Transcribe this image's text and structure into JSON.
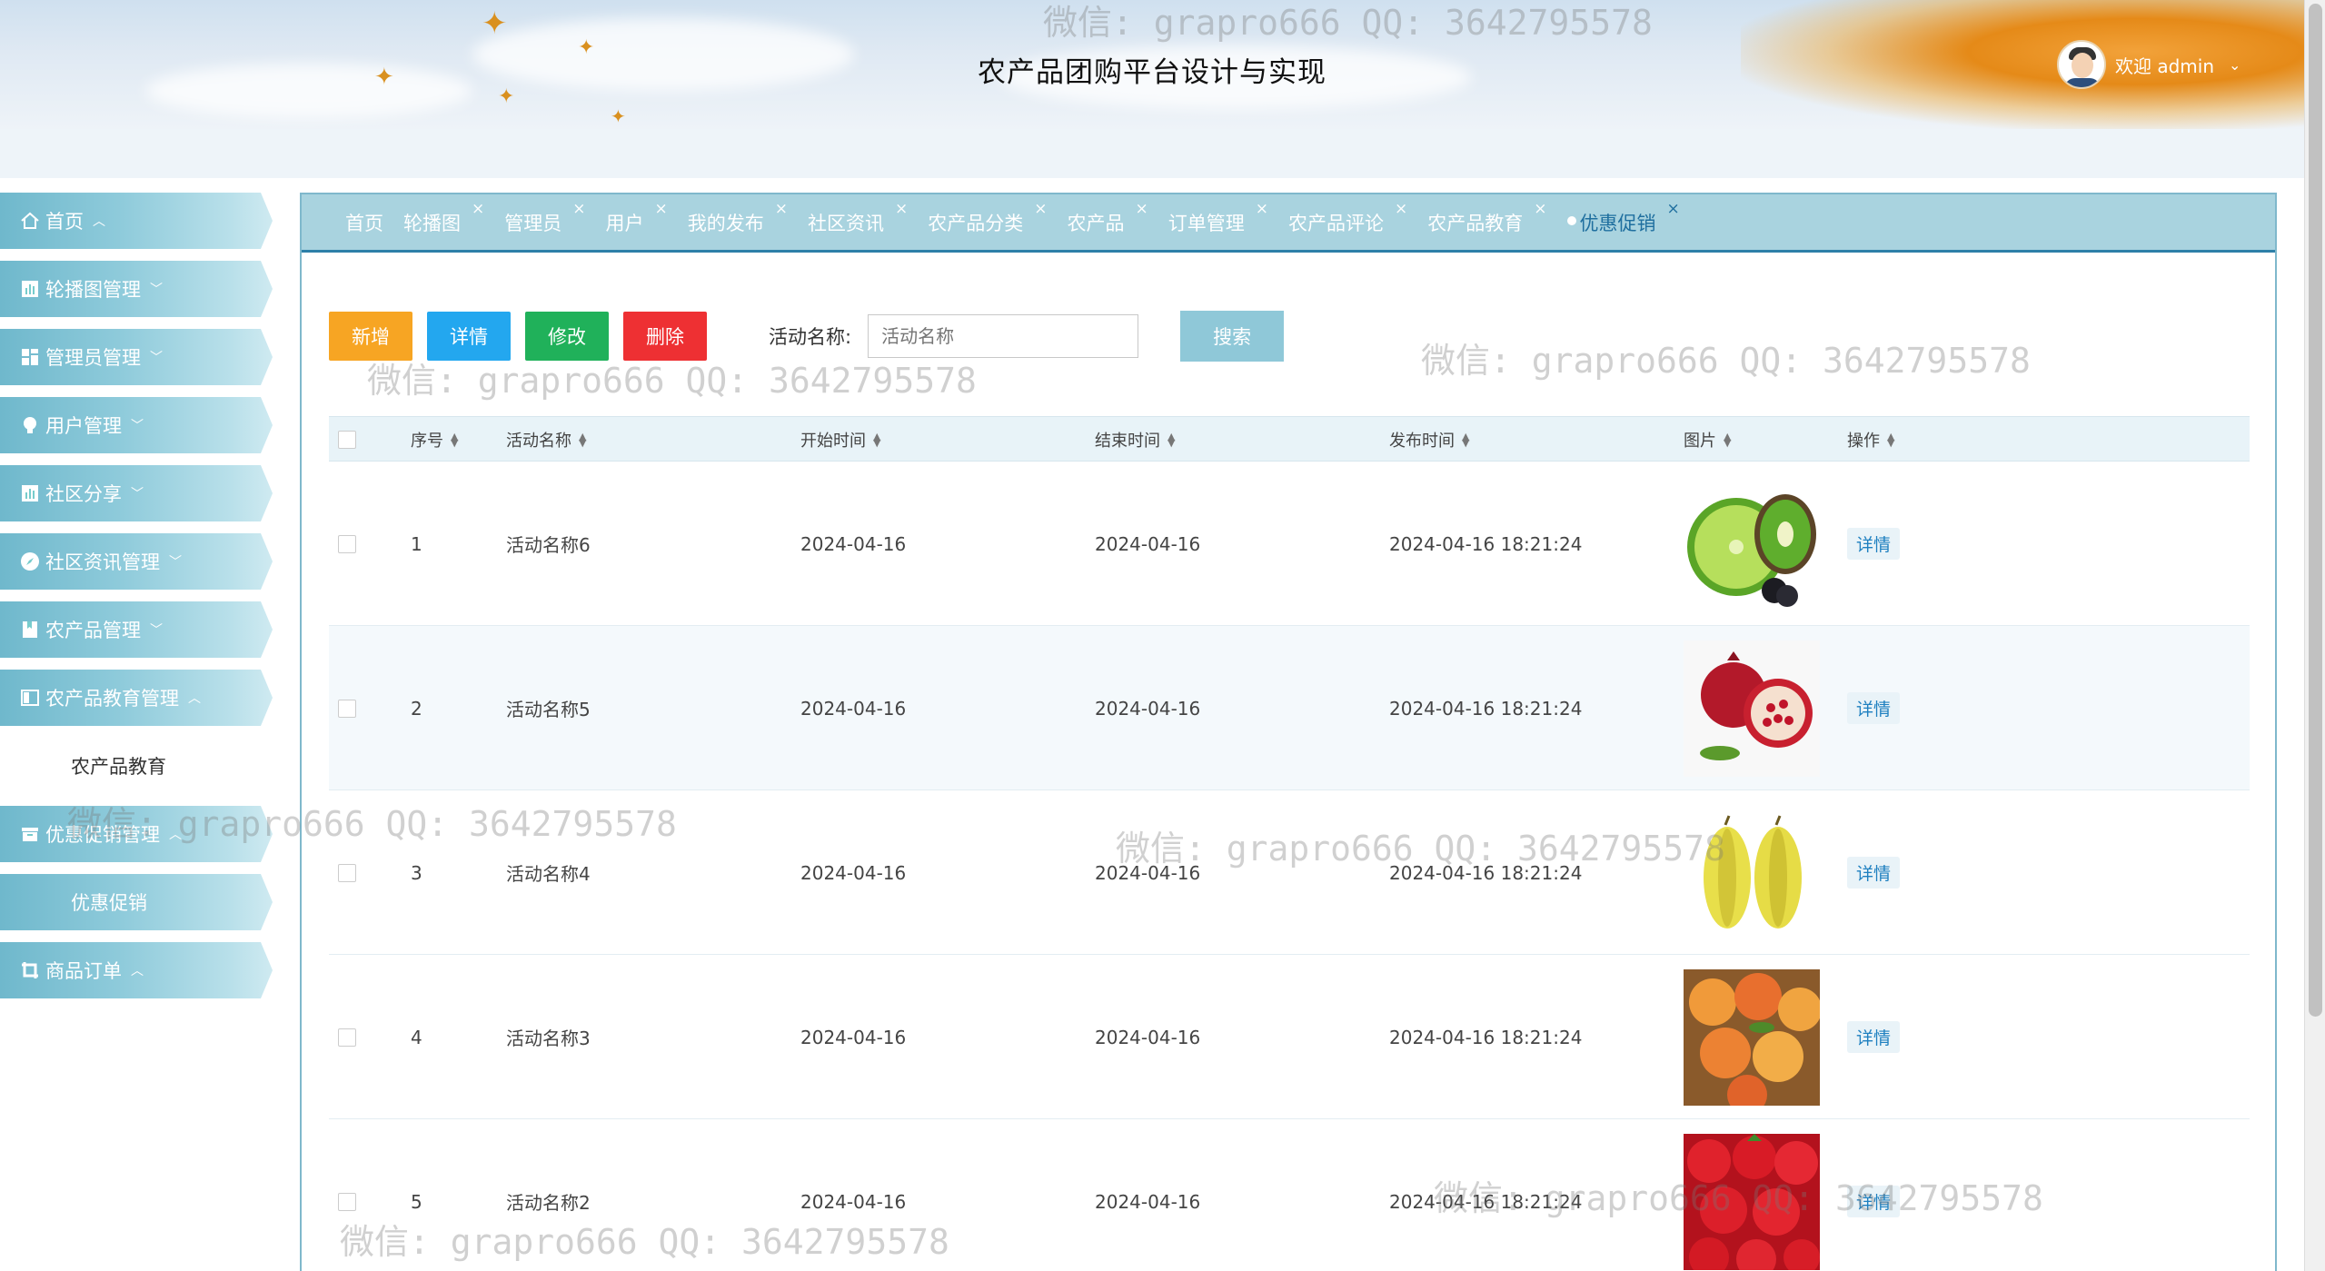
{
  "header": {
    "title": "农产品团购平台设计与实现",
    "welcome": "欢迎 admin",
    "user_menu_icon": "chevron-down-icon",
    "avatar_icon": "user-avatar-icon"
  },
  "sidebar": {
    "items": [
      {
        "label": "首页",
        "icon": "home-icon",
        "chevron": "chevron-up-icon"
      },
      {
        "label": "轮播图管理",
        "icon": "chart-icon",
        "chevron": "chevron-down-icon"
      },
      {
        "label": "管理员管理",
        "icon": "grid-icon",
        "chevron": "chevron-down-icon"
      },
      {
        "label": "用户管理",
        "icon": "user-icon",
        "chevron": "chevron-down-icon"
      },
      {
        "label": "社区分享",
        "icon": "chart-icon",
        "chevron": "chevron-down-icon"
      },
      {
        "label": "社区资讯管理",
        "icon": "compass-icon",
        "chevron": "chevron-down-icon"
      },
      {
        "label": "农产品管理",
        "icon": "bookmark-icon",
        "chevron": "chevron-down-icon"
      },
      {
        "label": "农产品教育管理",
        "icon": "panel-icon",
        "chevron": "chevron-up-icon"
      },
      {
        "label": "优惠促销管理",
        "icon": "box-icon",
        "chevron": "chevron-up-icon"
      },
      {
        "label": "商品订单",
        "icon": "crop-icon",
        "chevron": "chevron-up-icon"
      }
    ],
    "sub_education": "农产品教育",
    "sub_promotion": "优惠促销"
  },
  "tabs": [
    {
      "label": "首页",
      "closable": false
    },
    {
      "label": "轮播图",
      "closable": true
    },
    {
      "label": "管理员",
      "closable": true
    },
    {
      "label": "用户",
      "closable": true
    },
    {
      "label": "我的发布",
      "closable": true
    },
    {
      "label": "社区资讯",
      "closable": true
    },
    {
      "label": "农产品分类",
      "closable": true
    },
    {
      "label": "农产品",
      "closable": true
    },
    {
      "label": "订单管理",
      "closable": true
    },
    {
      "label": "农产品评论",
      "closable": true
    },
    {
      "label": "农产品教育",
      "closable": true
    },
    {
      "label": "优惠促销",
      "closable": true,
      "active": true
    }
  ],
  "tab_close_glyph": "×",
  "toolbar": {
    "add": "新增",
    "detail": "详情",
    "edit": "修改",
    "delete": "删除",
    "search_label": "活动名称:",
    "search_placeholder": "活动名称",
    "search_button": "搜索"
  },
  "table": {
    "columns": [
      "序号",
      "活动名称",
      "开始时间",
      "结束时间",
      "发布时间",
      "图片",
      "操作"
    ],
    "rows": [
      {
        "no": "1",
        "name": "活动名称6",
        "start": "2024-04-16",
        "end": "2024-04-16",
        "published": "2024-04-16 18:21:24",
        "image": "lime-kiwi-image",
        "action": "详情"
      },
      {
        "no": "2",
        "name": "活动名称5",
        "start": "2024-04-16",
        "end": "2024-04-16",
        "published": "2024-04-16 18:21:24",
        "image": "pomegranate-image",
        "action": "详情"
      },
      {
        "no": "3",
        "name": "活动名称4",
        "start": "2024-04-16",
        "end": "2024-04-16",
        "published": "2024-04-16 18:21:24",
        "image": "starfruit-image",
        "action": "详情"
      },
      {
        "no": "4",
        "name": "活动名称3",
        "start": "2024-04-16",
        "end": "2024-04-16",
        "published": "2024-04-16 18:21:24",
        "image": "peach-image",
        "action": "详情"
      },
      {
        "no": "5",
        "name": "活动名称2",
        "start": "2024-04-16",
        "end": "2024-04-16",
        "published": "2024-04-16 18:21:24",
        "image": "strawberry-image",
        "action": "详情"
      }
    ]
  },
  "watermark": "微信: grapro666 QQ: 3642795578",
  "colors": {
    "menu_gradient_start": "#6fb8cc",
    "tab_bar": "#a9d3df",
    "btn_add": "#f7a523",
    "btn_detail": "#23a7ef",
    "btn_edit": "#20b15a",
    "btn_delete": "#ee3033",
    "btn_search": "#8fc8d8"
  }
}
